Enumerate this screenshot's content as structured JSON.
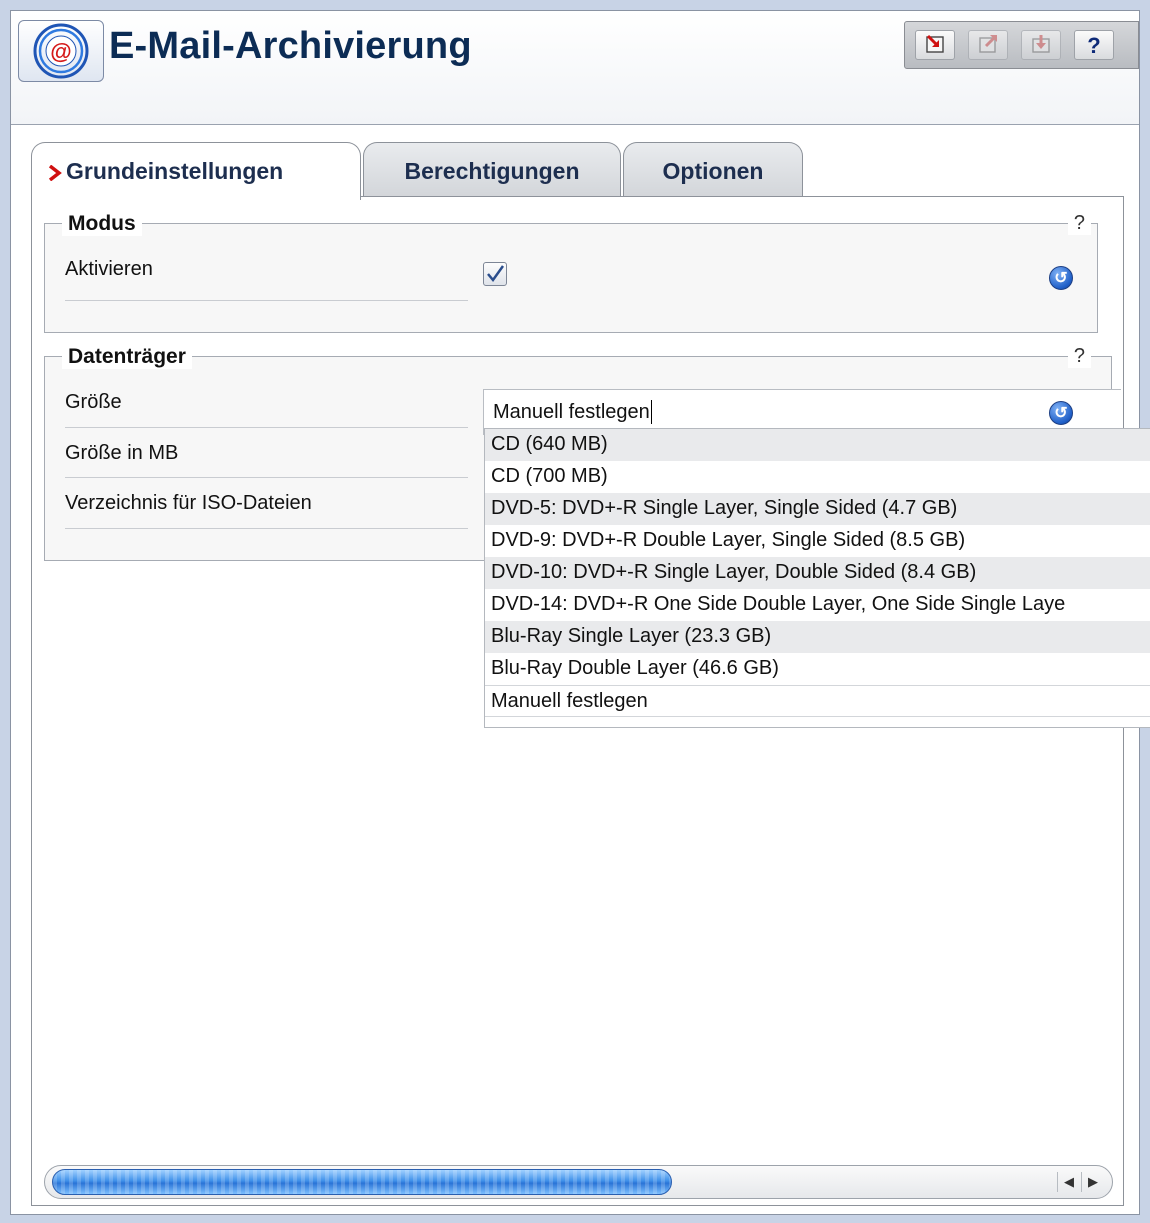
{
  "window": {
    "title": "E-Mail-Archivierung"
  },
  "toolbar": {
    "help_label": "?"
  },
  "tabs": [
    {
      "label": "Grundeinstellungen",
      "active": true
    },
    {
      "label": "Berechtigungen",
      "active": false
    },
    {
      "label": "Optionen",
      "active": false
    }
  ],
  "mode_group": {
    "title": "Modus",
    "help": "?",
    "activate_label": "Aktivieren",
    "activate_checked": true
  },
  "media_group": {
    "title": "Datenträger",
    "help": "?",
    "size_label": "Größe",
    "size_mb_label": "Größe in MB",
    "iso_dir_label": "Verzeichnis für ISO-Dateien",
    "size_value": "Manuell festlegen",
    "options": [
      "CD (640 MB)",
      "CD (700 MB)",
      "DVD-5: DVD+-R Single Layer, Single Sided (4.7 GB)",
      "DVD-9: DVD+-R Double Layer, Single Sided (8.5 GB)",
      "DVD-10: DVD+-R Single Layer, Double Sided (8.4 GB)",
      "DVD-14: DVD+-R One Side Double Layer, One Side Single Laye",
      "Blu-Ray Single Layer (23.3 GB)",
      "Blu-Ray Double Layer (46.6 GB)",
      "Manuell festlegen"
    ]
  },
  "scrollbar": {
    "position": 0.0,
    "visible_fraction": 0.62
  },
  "colors": {
    "title": "#0c2c55",
    "accent": "#2a74d7",
    "tab_marker": "#d01010"
  }
}
